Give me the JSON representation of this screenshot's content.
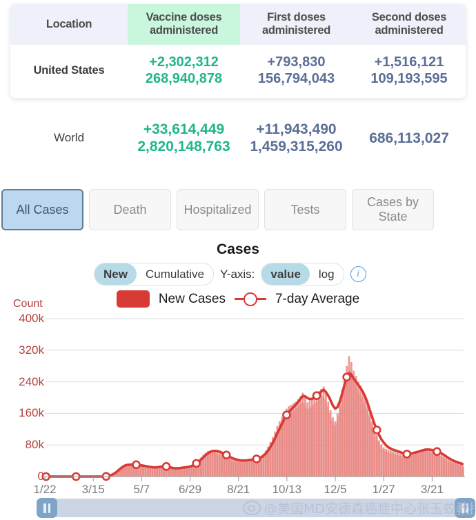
{
  "table": {
    "headers": [
      "Location",
      "Vaccine doses administered",
      "First doses administered",
      "Second doses administered"
    ],
    "header_lines": [
      {
        "l1": "Location",
        "l2": ""
      },
      {
        "l1": "Vaccine doses",
        "l2": "administered"
      },
      {
        "l1": "First doses",
        "l2": "administered"
      },
      {
        "l1": "Second doses",
        "l2": "administered"
      }
    ],
    "rows": [
      {
        "location": "United States",
        "vaccine_change": "+2,302,312",
        "vaccine_total": "268,940,878",
        "first_change": "+793,830",
        "first_total": "156,794,043",
        "second_change": "+1,516,121",
        "second_total": "109,193,595"
      },
      {
        "location": "World",
        "vaccine_change": "+33,614,449",
        "vaccine_total": "2,820,148,763",
        "first_change": "+11,943,490",
        "first_total": "1,459,315,260",
        "second_change": "",
        "second_total": "686,113,027"
      }
    ],
    "highlight_color": "#c9f7dd",
    "accent_green": "#21b58c",
    "accent_blue": "#5a6e96"
  },
  "tabs": [
    {
      "label": "All Cases",
      "active": true
    },
    {
      "label": "Death",
      "active": false
    },
    {
      "label": "Hospitalized",
      "active": false
    },
    {
      "label": "Tests",
      "active": false
    },
    {
      "label": "Cases by State",
      "active": false
    }
  ],
  "chart_header": {
    "title": "Cases",
    "mode_new": "New",
    "mode_cumulative": "Cumulative",
    "yaxis_label": "Y-axis:",
    "scale_value": "value",
    "scale_log": "log",
    "info_glyph": "i",
    "selected_mode": "New",
    "selected_scale": "value"
  },
  "legend": [
    {
      "label": "New Cases",
      "type": "bar",
      "color": "#d83a35"
    },
    {
      "label": "7-day Average",
      "type": "line-marker",
      "color": "#d83a35"
    }
  ],
  "slider": {
    "left_handle": "pause-grip",
    "right_handle": "pause-grip"
  },
  "watermark": {
    "text": "@美国MD安德森癌症中心张玉蛟教授",
    "icon": "weibo-eye-icon"
  },
  "chart_data": {
    "type": "bar",
    "title": "Cases",
    "xlabel": "",
    "ylabel": "Count",
    "ylim": [
      0,
      400000
    ],
    "yticks": [
      0,
      80000,
      160000,
      240000,
      320000,
      400000
    ],
    "ytick_labels": [
      "0",
      "80k",
      "160k",
      "240k",
      "320k",
      "400k"
    ],
    "xticks": [
      "1/22",
      "3/15",
      "5/7",
      "6/29",
      "8/21",
      "10/13",
      "12/5",
      "1/27",
      "3/21"
    ],
    "grid": true,
    "legend_position": "top",
    "bar_color": "#e8817c",
    "line_color": "#d83a35",
    "series": [
      {
        "name": "New Cases",
        "type": "bar",
        "values": [
          0,
          0,
          0,
          0,
          0,
          0,
          0,
          0,
          0,
          0,
          0,
          0,
          0,
          0,
          0,
          0,
          0,
          0,
          0,
          0,
          0,
          0,
          0,
          0,
          0,
          0,
          300,
          1200,
          3000,
          5500,
          9000,
          14000,
          19000,
          24000,
          28000,
          31000,
          30000,
          29500,
          31000,
          30000,
          29000,
          28000,
          27500,
          26000,
          25000,
          24000,
          23000,
          22500,
          24000,
          25000,
          26000,
          27000,
          26000,
          24000,
          22000,
          21000,
          20000,
          21000,
          22000,
          23000,
          24000,
          25000,
          26000,
          28000,
          31000,
          36000,
          42000,
          48000,
          55000,
          60000,
          64000,
          66000,
          67000,
          66000,
          64000,
          62000,
          58000,
          55000,
          52000,
          48000,
          45000,
          43000,
          42000,
          41000,
          40000,
          40000,
          41000,
          42000,
          43000,
          44000,
          45000,
          46000,
          48000,
          52000,
          58000,
          66000,
          76000,
          88000,
          100000,
          114000,
          128000,
          140000,
          152000,
          164000,
          172000,
          178000,
          182000,
          186000,
          190000,
          196000,
          204000,
          212000,
          200000,
          188000,
          192000,
          198000,
          205000,
          210000,
          216000,
          222000,
          228000,
          210000,
          190000,
          168000,
          150000,
          140000,
          160000,
          188000,
          220000,
          250000,
          280000,
          305000,
          290000,
          268000,
          255000,
          240000,
          230000,
          215000,
          200000,
          180000,
          160000,
          140000,
          122000,
          105000,
          92000,
          82000,
          74000,
          70000,
          68000,
          66000,
          64000,
          62000,
          60000,
          58000,
          56000,
          55000,
          56000,
          58000,
          60000,
          62000,
          64000,
          66000,
          68000,
          70000,
          72000,
          70000,
          68000,
          66000,
          64000,
          62000,
          60000,
          56000,
          52000,
          48000,
          44000,
          40000,
          38000,
          36000,
          34000,
          32000,
          30000
        ]
      },
      {
        "name": "7-day Average",
        "type": "line",
        "marker_every": 13,
        "values": [
          0,
          0,
          0,
          0,
          0,
          0,
          0,
          0,
          0,
          0,
          0,
          0,
          0,
          0,
          0,
          0,
          0,
          0,
          0,
          0,
          0,
          0,
          0,
          0,
          0,
          0,
          400,
          1500,
          3200,
          6000,
          9500,
          14500,
          19500,
          24000,
          27500,
          29500,
          30000,
          30200,
          30500,
          30000,
          29200,
          28400,
          27600,
          26500,
          25400,
          24500,
          23600,
          23000,
          23600,
          24400,
          25200,
          26000,
          25600,
          24400,
          22800,
          21600,
          20800,
          21000,
          21600,
          22400,
          23200,
          24000,
          25000,
          26800,
          29600,
          33400,
          38000,
          43000,
          49000,
          54500,
          59000,
          62500,
          64500,
          65000,
          64500,
          63000,
          60500,
          57500,
          54500,
          51000,
          48000,
          45500,
          43500,
          42000,
          41000,
          40500,
          40600,
          41200,
          42000,
          42800,
          43600,
          44600,
          46000,
          48800,
          52800,
          58400,
          66000,
          75000,
          85200,
          97000,
          110000,
          122000,
          134000,
          146000,
          156000,
          164000,
          170000,
          176000,
          182000,
          189000,
          197000,
          204000,
          203000,
          199000,
          196000,
          197000,
          200000,
          205000,
          210000,
          216000,
          220000,
          214000,
          205000,
          193000,
          180000,
          172000,
          176000,
          190000,
          210000,
          232000,
          252000,
          262000,
          258000,
          248000,
          240000,
          232000,
          224000,
          214000,
          202000,
          186000,
          168000,
          150000,
          133000,
          118000,
          105000,
          94000,
          86000,
          79000,
          74000,
          71000,
          68000,
          66000,
          64000,
          62000,
          60000,
          58000,
          57000,
          57500,
          58500,
          60000,
          61500,
          63000,
          65000,
          66500,
          68000,
          68500,
          68000,
          67000,
          65500,
          63500,
          61500,
          58500,
          55000,
          51000,
          47000,
          43500,
          40500,
          38000,
          36000,
          34000,
          32000
        ]
      }
    ]
  }
}
